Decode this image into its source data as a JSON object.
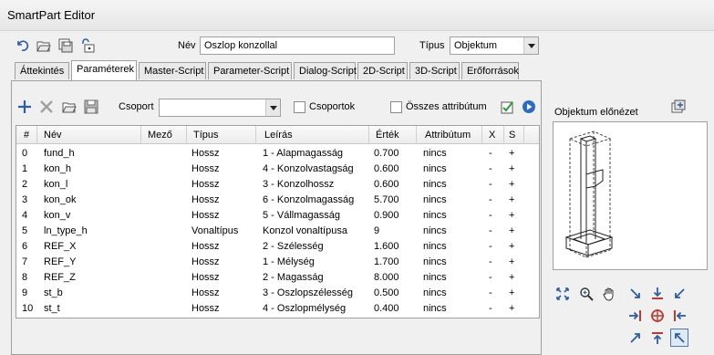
{
  "window": {
    "title": "SmartPart Editor"
  },
  "toolbar": {
    "icons": [
      "undo-icon",
      "open-folder-icon",
      "save-copy-icon",
      "unlock-icon"
    ]
  },
  "name_field": {
    "label": "Név",
    "value": "Oszlop konzollal"
  },
  "type_field": {
    "label": "Típus",
    "value": "Objektum"
  },
  "tabs": [
    {
      "label": "Áttekintés"
    },
    {
      "label": "Paraméterek"
    },
    {
      "label": "Master-Script"
    },
    {
      "label": "Parameter-Script"
    },
    {
      "label": "Dialog-Script"
    },
    {
      "label": "2D-Script"
    },
    {
      "label": "3D-Script"
    },
    {
      "label": "Erőforrások"
    }
  ],
  "active_tab": "Paraméterek",
  "param_toolbar": {
    "group_label": "Csoport",
    "group_value": "",
    "groups_checkbox": "Csoportok",
    "all_attributes_checkbox": "Összes attribútum"
  },
  "table": {
    "headers": [
      "#",
      "Név",
      "Mező",
      "Típus",
      "Leírás",
      "Érték",
      "Attribútum",
      "X",
      "S"
    ],
    "rows": [
      [
        "0",
        "fund_h",
        "",
        "Hossz",
        "1 - Alapmagasság",
        "0.700",
        "nincs",
        "-",
        "+"
      ],
      [
        "1",
        "kon_h",
        "",
        "Hossz",
        "4 - Konzolvastagság",
        "0.600",
        "nincs",
        "-",
        "+"
      ],
      [
        "2",
        "kon_l",
        "",
        "Hossz",
        "3 - Konzolhossz",
        "0.600",
        "nincs",
        "-",
        "+"
      ],
      [
        "3",
        "kon_ok",
        "",
        "Hossz",
        "6 - Konzolmagasság",
        "5.700",
        "nincs",
        "-",
        "+"
      ],
      [
        "4",
        "kon_v",
        "",
        "Hossz",
        "5 - Vállmagasság",
        "0.900",
        "nincs",
        "-",
        "+"
      ],
      [
        "5",
        "ln_type_h",
        "",
        "Vonaltípus",
        "Konzol vonaltípusa",
        "9",
        "nincs",
        "-",
        "+"
      ],
      [
        "6",
        "REF_X",
        "",
        "Hossz",
        "2 - Szélesség",
        "1.600",
        "nincs",
        "-",
        "+"
      ],
      [
        "7",
        "REF_Y",
        "",
        "Hossz",
        "1 - Mélység",
        "1.700",
        "nincs",
        "-",
        "+"
      ],
      [
        "8",
        "REF_Z",
        "",
        "Hossz",
        "2 - Magasság",
        "8.000",
        "nincs",
        "-",
        "+"
      ],
      [
        "9",
        "st_b",
        "",
        "Hossz",
        "3 - Oszlopszélesség",
        "0.500",
        "nincs",
        "-",
        "+"
      ],
      [
        "10",
        "st_t",
        "",
        "Hossz",
        "4 - Oszlopmélység",
        "0.400",
        "nincs",
        "-",
        "+"
      ]
    ]
  },
  "preview": {
    "label": "Objektum előnézet"
  },
  "colors": {
    "accent_blue": "#1f5fb4",
    "selected_border": "#4a78b8"
  }
}
